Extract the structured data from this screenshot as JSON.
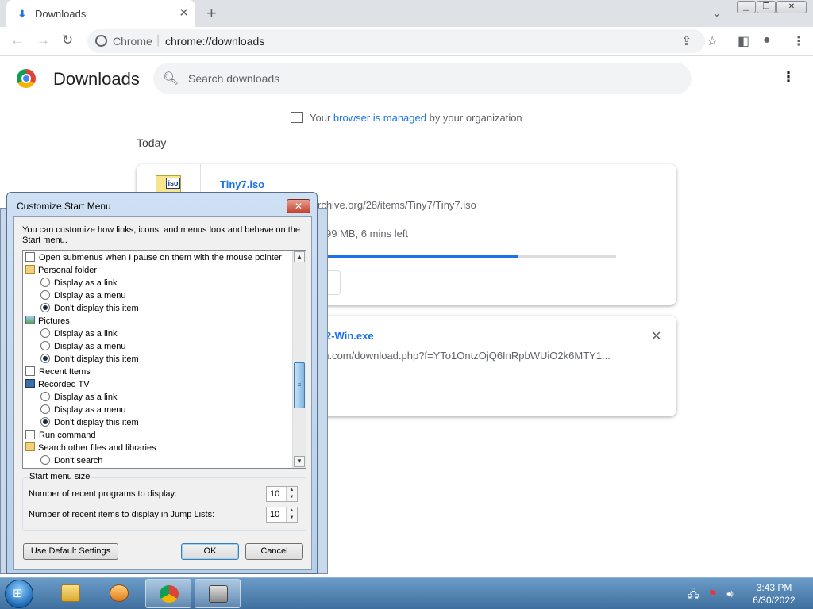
{
  "browser": {
    "tab_title": "Downloads",
    "site_label": "Chrome",
    "url": "chrome://downloads"
  },
  "downloads": {
    "title": "Downloads",
    "search_placeholder": "Search downloads",
    "managed_prefix": "Your",
    "managed_link": "browser is managed",
    "managed_suffix": "by your organization",
    "section_today": "Today",
    "items": [
      {
        "icon_label": "iso",
        "filename": "Tiny7.iso",
        "url": "rchive.org/28/items/Tiny7/Tiny7.iso",
        "status": "99 MB, 6 mins left",
        "progress_fraction": 0.66
      },
      {
        "filename": "2-Win.exe",
        "url": "on.com/download.php?f=YTo1OntzOjQ6InRpbWUiO2k6MTY1..."
      }
    ]
  },
  "dialog": {
    "title": "Customize Start Menu",
    "close_label": "✕",
    "intro": "You can customize how links, icons, and menus look and behave on the Start menu.",
    "options": [
      {
        "kind": "checkbox",
        "label": "Open submenus when I pause on them with the mouse pointer",
        "checked": false
      },
      {
        "kind": "group",
        "icon": "folder",
        "label": "Personal folder"
      },
      {
        "kind": "radio",
        "label": "Display as a link",
        "checked": false
      },
      {
        "kind": "radio",
        "label": "Display as a menu",
        "checked": false
      },
      {
        "kind": "radio",
        "label": "Don't display this item",
        "checked": true
      },
      {
        "kind": "group",
        "icon": "pictures",
        "label": "Pictures"
      },
      {
        "kind": "radio",
        "label": "Display as a link",
        "checked": false
      },
      {
        "kind": "radio",
        "label": "Display as a menu",
        "checked": false
      },
      {
        "kind": "radio",
        "label": "Don't display this item",
        "checked": true
      },
      {
        "kind": "checkbox",
        "label": "Recent Items",
        "checked": false
      },
      {
        "kind": "group",
        "icon": "tv",
        "label": "Recorded TV"
      },
      {
        "kind": "radio",
        "label": "Display as a link",
        "checked": false
      },
      {
        "kind": "radio",
        "label": "Display as a menu",
        "checked": false
      },
      {
        "kind": "radio",
        "label": "Don't display this item",
        "checked": true
      },
      {
        "kind": "checkbox",
        "label": "Run command",
        "checked": false
      },
      {
        "kind": "group",
        "icon": "folder",
        "label": "Search other files and libraries"
      },
      {
        "kind": "radio",
        "label": "Don't search",
        "checked": false
      }
    ],
    "size_legend": "Start menu size",
    "recent_programs_label": "Number of recent programs to display:",
    "recent_programs_value": "10",
    "jump_list_label": "Number of recent items to display in Jump Lists:",
    "jump_list_value": "10",
    "default_button": "Use Default Settings",
    "ok_button": "OK",
    "cancel_button": "Cancel"
  },
  "taskbar": {
    "time": "3:43 PM",
    "date": "6/30/2022"
  }
}
